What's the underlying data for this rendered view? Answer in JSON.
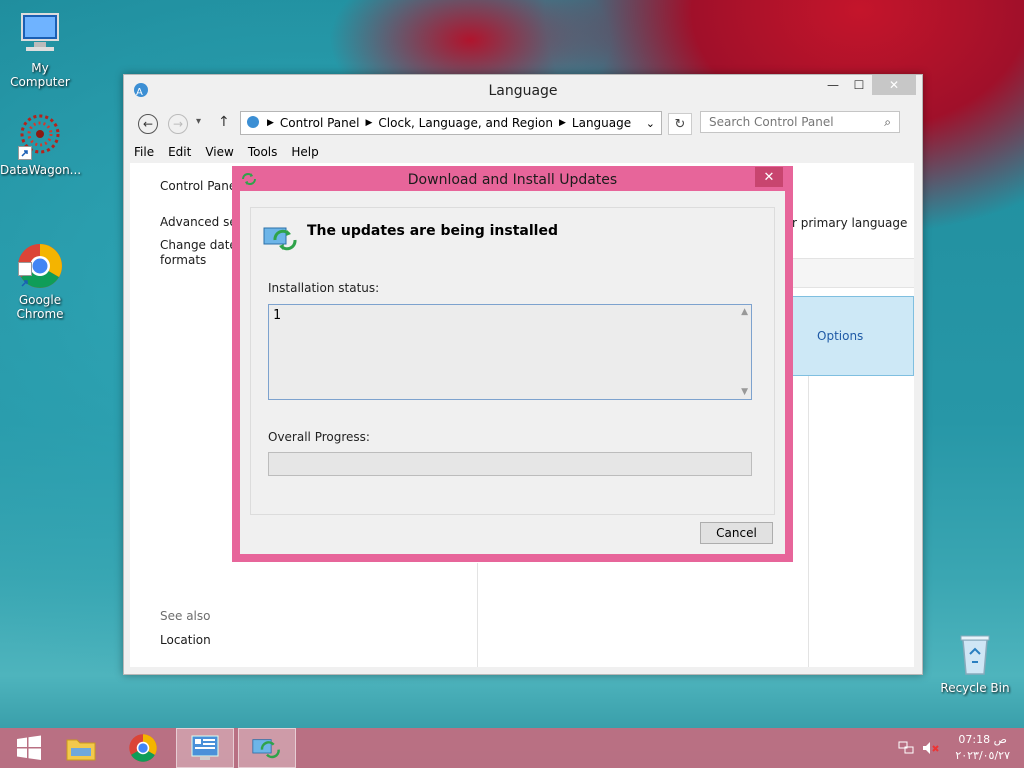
{
  "desktop": {
    "icons": [
      {
        "label": "My Computer"
      },
      {
        "label": "DataWagon..."
      },
      {
        "label": "Google\nChrome"
      },
      {
        "label": "Recycle Bin"
      }
    ]
  },
  "language_window": {
    "title": "Language",
    "breadcrumb": [
      "Control Panel",
      "Clock, Language, and Region",
      "Language"
    ],
    "search_placeholder": "Search Control Panel",
    "menu": [
      "File",
      "Edit",
      "View",
      "Tools",
      "Help"
    ],
    "left_links": {
      "home": "Control Panel",
      "advanced": "Advanced set",
      "change_date": "Change date,",
      "formats": "formats",
      "see_also": "See also",
      "location": "Location"
    },
    "primary_language_text": "r primary language",
    "options": "Options"
  },
  "dialog": {
    "title": "Download and Install Updates",
    "heading": "The updates are being installed",
    "status_label": "Installation status:",
    "status_text": "1",
    "progress_label": "Overall Progress:",
    "progress_value": 0,
    "cancel": "Cancel"
  },
  "taskbar": {
    "time": "07:18 ص",
    "date": "٢٠٢٣/٠٥/٢٧"
  },
  "colors": {
    "dialog_frame": "#e7659a",
    "taskbar": "#c46c80",
    "accent_blue": "#7da2ce"
  }
}
